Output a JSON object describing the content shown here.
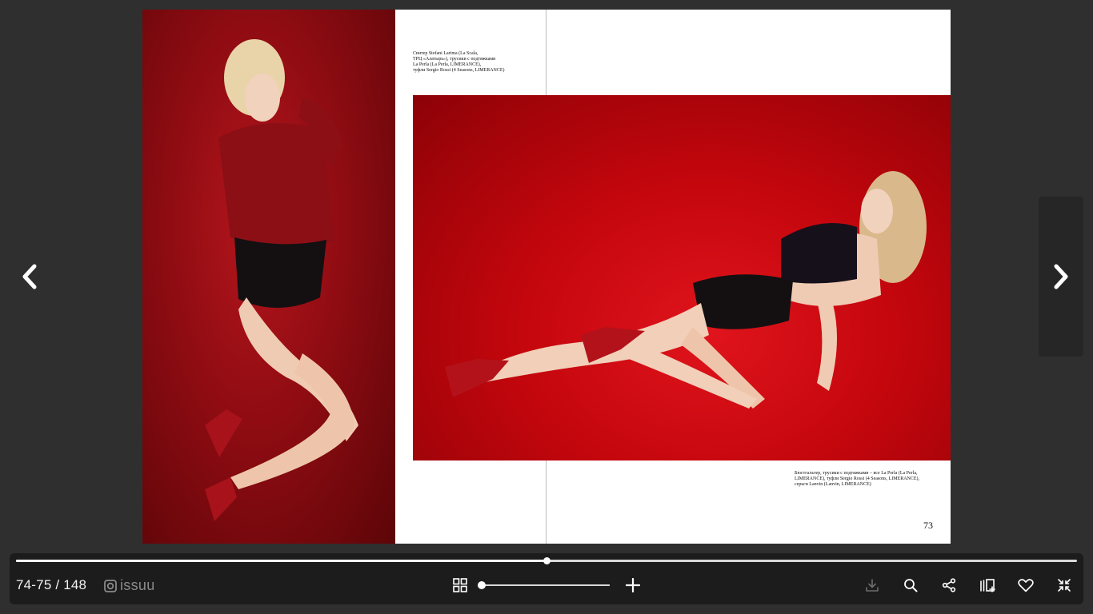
{
  "viewer": {
    "page_indicator": "74-75 / 148",
    "brand": "issuu",
    "progress": 0.5,
    "zoom_level": 0.0
  },
  "spread": {
    "caption_top": "Свитер Stefani Larima (La Scala,\nТРЦ «Алатырь»), трусики с подтяжками\nLa Perla (La Perla, LIMERANCE),\nтуфли Sergio Rossi (4 Seasons, LIMERANCE)",
    "caption_bottom": "Бюстгальтер, трусики с подтяжками – все La Perla (La Perla,\nLIMERANCE), туфли Sergio Rossi (4 Seasons, LIMERANCE),\nсерьги Lanvin (Lanvin, LIMERANCE)",
    "page_number": "73"
  },
  "icons": {
    "prev": "chevron-left-icon",
    "next": "chevron-right-icon",
    "grid": "grid-icon",
    "zoom_in": "plus-icon",
    "download": "download-icon",
    "search": "search-icon",
    "share": "share-icon",
    "stack": "add-to-stack-icon",
    "like": "heart-icon",
    "fullscreen_exit": "exit-fullscreen-icon"
  },
  "colors": {
    "background": "#2f2f2f",
    "toolbar": "#1c1c1c",
    "photo_red": "#c4060d"
  }
}
